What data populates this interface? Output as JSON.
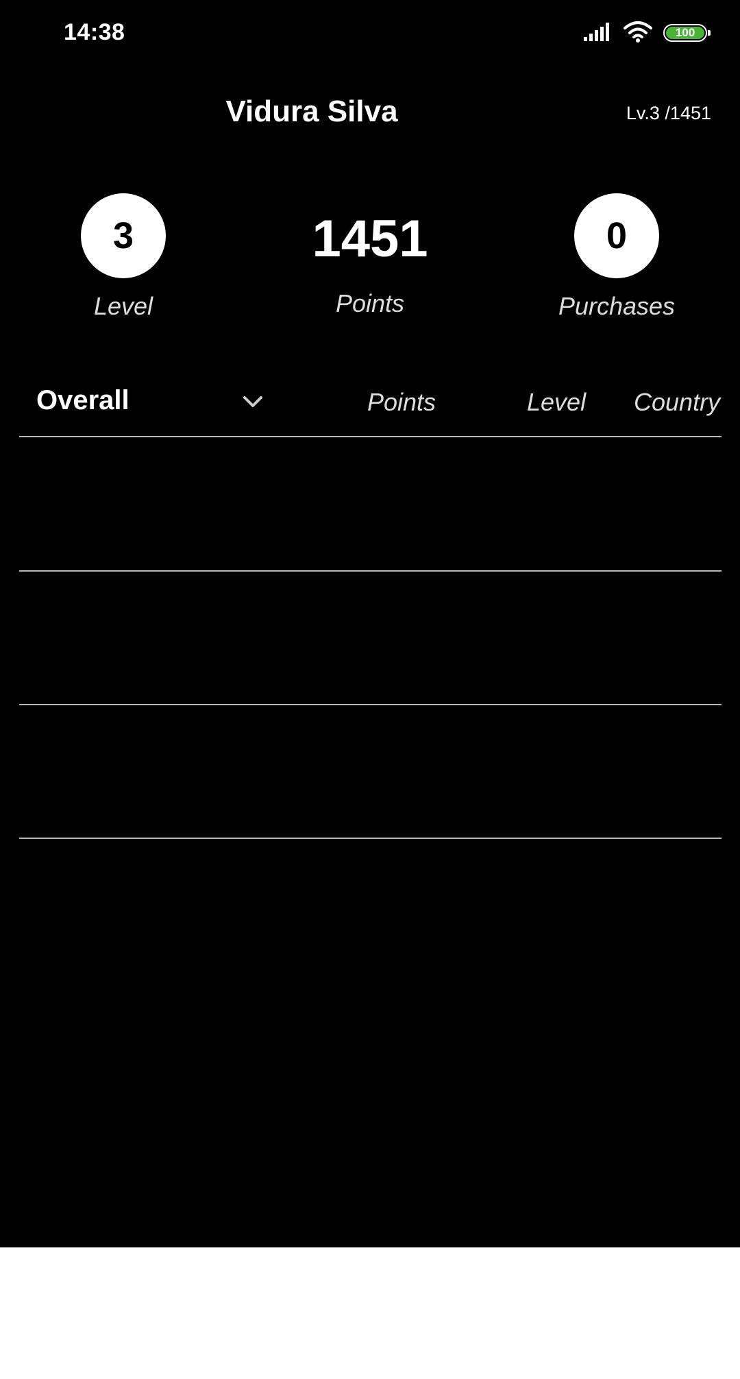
{
  "status_bar": {
    "time": "14:38",
    "battery_level": "100",
    "battery_color": "#4cb33a",
    "icons": [
      "signal-icon",
      "wifi-icon",
      "battery-icon"
    ]
  },
  "header": {
    "user_name": "Vidura Silva",
    "level_points": "Lv.3 /1451"
  },
  "stats": {
    "level": {
      "value": "3",
      "label": "Level"
    },
    "points": {
      "value": "1451",
      "label": "Points"
    },
    "purchases": {
      "value": "0",
      "label": "Purchases"
    }
  },
  "leaderboard": {
    "filter_selected": "Overall",
    "columns": [
      "Points",
      "Level",
      "Country"
    ],
    "rows": []
  }
}
